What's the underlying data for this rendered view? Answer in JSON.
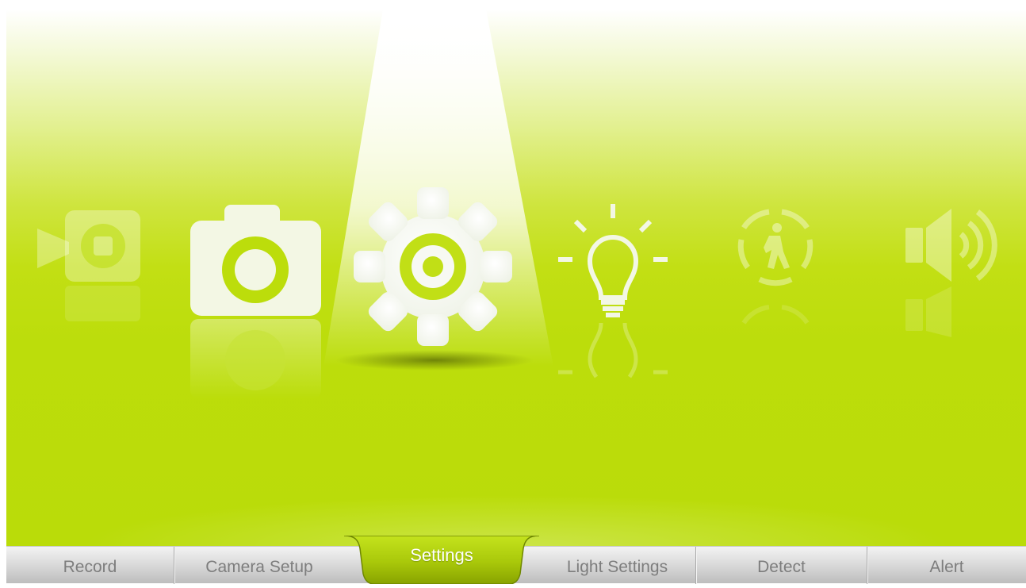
{
  "app": {
    "selected_tab": "Settings"
  },
  "colors": {
    "accent_green": "#bcdd0b",
    "tab_gray": "#d6d6d6",
    "tab_text": "#7d7d7d",
    "active_tab_text": "#ffffff"
  },
  "carousel": {
    "items": [
      {
        "id": "record",
        "icon": "video-record-icon",
        "state": "faded"
      },
      {
        "id": "camera_setup",
        "icon": "camera-icon",
        "state": "near"
      },
      {
        "id": "settings",
        "icon": "gear-icon",
        "state": "selected"
      },
      {
        "id": "light_settings",
        "icon": "light-bulb-icon",
        "state": "near"
      },
      {
        "id": "detect",
        "icon": "motion-detect-icon",
        "state": "faded"
      },
      {
        "id": "alert",
        "icon": "speaker-icon",
        "state": "faded"
      }
    ]
  },
  "tabs": [
    {
      "id": "record",
      "label": "Record"
    },
    {
      "id": "camera_setup",
      "label": "Camera Setup"
    },
    {
      "id": "settings",
      "label": "Settings",
      "active": true
    },
    {
      "id": "light_settings",
      "label": "Light Settings"
    },
    {
      "id": "detect",
      "label": "Detect"
    },
    {
      "id": "alert",
      "label": "Alert"
    }
  ]
}
